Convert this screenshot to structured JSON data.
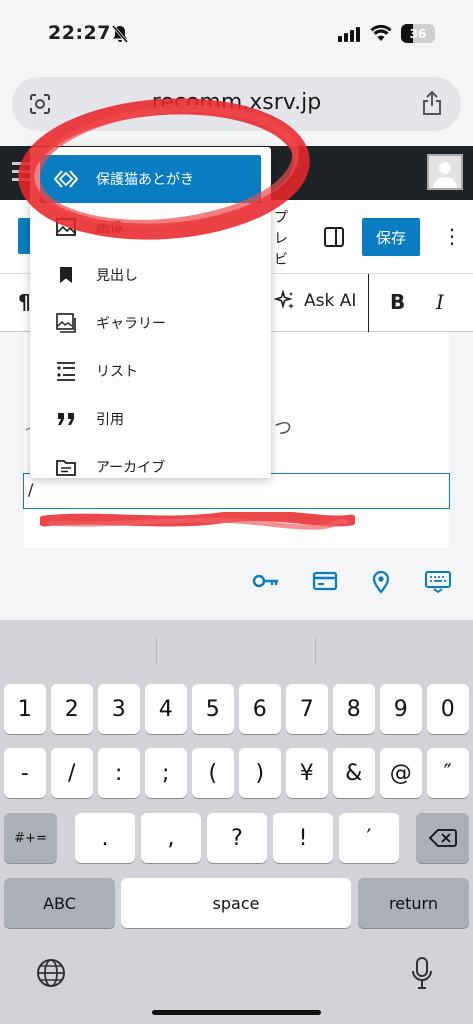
{
  "status": {
    "time": "22:27",
    "battery": "36"
  },
  "browser": {
    "url": "recomm.xsrv.jp"
  },
  "toolbar": {
    "preview_label": "プレビュー",
    "save_label": "保存",
    "more_label": "⋮"
  },
  "blocktools": {
    "paragraph_icon": "¶",
    "ask_ai_label": "Ask AI",
    "bold_label": "B",
    "italic_label": "I"
  },
  "content": {
    "left_fragment": "イ",
    "right_fragment": "つ",
    "input_value": "/"
  },
  "inserter": {
    "items": [
      {
        "label": "保護猫あとがき",
        "icon": "reusable-block-icon"
      },
      {
        "label": "画像",
        "icon": "image-icon"
      },
      {
        "label": "見出し",
        "icon": "bookmark-icon"
      },
      {
        "label": "ギャラリー",
        "icon": "gallery-icon"
      },
      {
        "label": "リスト",
        "icon": "list-icon"
      },
      {
        "label": "引用",
        "icon": "quote-icon"
      },
      {
        "label": "アーカイブ",
        "icon": "archive-icon"
      }
    ]
  },
  "keyboard": {
    "row1": [
      "1",
      "2",
      "3",
      "4",
      "5",
      "6",
      "7",
      "8",
      "9",
      "0"
    ],
    "row2": [
      "-",
      "/",
      ":",
      ";",
      "(",
      ")",
      "¥",
      "&",
      "@",
      "″"
    ],
    "row3_left": "#+=",
    "row3": [
      ".",
      ",",
      "?",
      "!",
      "′"
    ],
    "abc_label": "ABC",
    "space_label": "space",
    "return_label": "return"
  },
  "colors": {
    "accent": "#0a7cc1",
    "admin_bar": "#1d2327",
    "annotation_red": "#e8272b"
  }
}
